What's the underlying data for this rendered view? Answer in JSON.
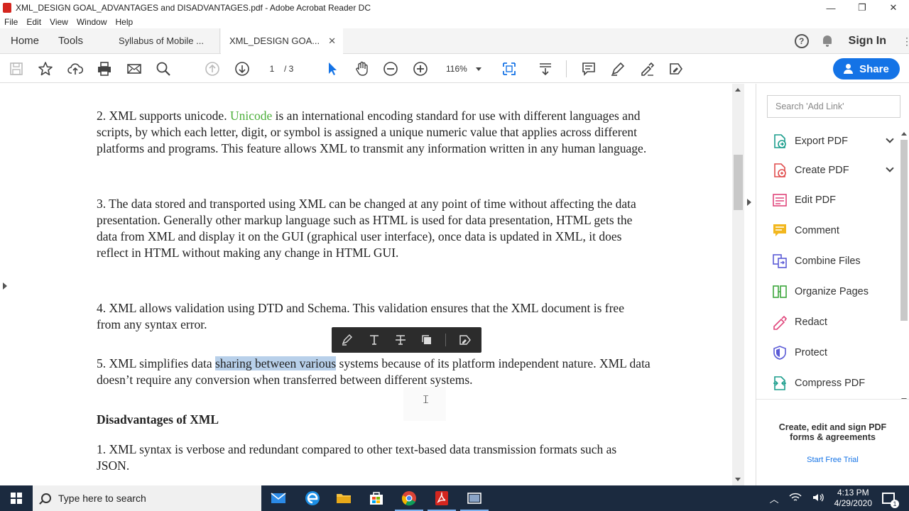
{
  "window": {
    "title": "XML_DESIGN GOAL_ADVANTAGES and DISADVANTAGES.pdf - Adobe Acrobat Reader DC",
    "controls": {
      "minimize": "—",
      "restore": "❐",
      "close": "✕"
    }
  },
  "menubar": {
    "items": [
      "File",
      "Edit",
      "View",
      "Window",
      "Help"
    ]
  },
  "tabs": {
    "home": "Home",
    "tools": "Tools",
    "documents": [
      {
        "label": "Syllabus of Mobile ...",
        "active": false
      },
      {
        "label": "XML_DESIGN GOA...",
        "active": true,
        "close": "✕"
      }
    ],
    "help": "?",
    "sign_in": "Sign In",
    "more": "⋮"
  },
  "toolbar": {
    "page_current": "1",
    "page_total": "/ 3",
    "zoom": "116%",
    "share_label": "Share",
    "colors": {
      "share_bg": "#1473e6",
      "selection_tool": "#1473e6"
    }
  },
  "document": {
    "para2": {
      "num": "2. XML supports unicode. ",
      "link": "Unicode",
      "rest": " is an international encoding standard for use with different languages and scripts, by which each letter, digit, or symbol is assigned a unique numeric value that applies across different platforms and programs. This feature allows XML to transmit any information written in any human language."
    },
    "para3": "3. The data stored and transported using XML can be changed at any point of time without affecting the data presentation. Generally other markup language such as HTML is used for data presentation, HTML gets the data from XML and display it on the GUI (graphical user interface), once data is updated in XML, it does reflect in HTML without making any change in HTML GUI.",
    "para4": "4. XML allows validation using DTD and Schema. This validation ensures that the XML document is free from any syntax error.",
    "para5": {
      "before": "5. XML simplifies data ",
      "selected": "sharing between various",
      "after": " systems because of its platform independent nature. XML data doesn’t require any conversion when transferred between different systems."
    },
    "heading_disadvantages": "Disadvantages of XML",
    "dis1": "1. XML syntax is verbose and redundant compared to other text-based data transmission formats such as JSON.",
    "colors": {
      "link": "#4caf3a",
      "selection": "#b8d0ea"
    }
  },
  "selection_toolbar": {
    "icons": [
      "highlight-icon",
      "strikethrough-text-icon",
      "replace-text-icon",
      "copy-icon",
      "more-options-icon"
    ]
  },
  "right_pane": {
    "search_placeholder": "Search 'Add Link'",
    "tools": [
      {
        "label": "Export PDF",
        "icon": "export-pdf-icon",
        "expandable": true,
        "color": "#1a9d8c"
      },
      {
        "label": "Create PDF",
        "icon": "create-pdf-icon",
        "expandable": true,
        "color": "#e04c4c"
      },
      {
        "label": "Edit PDF",
        "icon": "edit-pdf-icon",
        "expandable": false,
        "color": "#e0457b"
      },
      {
        "label": "Comment",
        "icon": "comment-icon",
        "expandable": false,
        "color": "#f2b71f"
      },
      {
        "label": "Combine Files",
        "icon": "combine-files-icon",
        "expandable": false,
        "color": "#5b5bd6"
      },
      {
        "label": "Organize Pages",
        "icon": "organize-pages-icon",
        "expandable": false,
        "color": "#3ca63c"
      },
      {
        "label": "Redact",
        "icon": "redact-icon",
        "expandable": false,
        "color": "#e0457b"
      },
      {
        "label": "Protect",
        "icon": "protect-icon",
        "expandable": false,
        "color": "#5b5bd6"
      },
      {
        "label": "Compress PDF",
        "icon": "compress-pdf-icon",
        "expandable": false,
        "color": "#1a9d8c"
      }
    ],
    "promo": {
      "title_line1": "Create, edit and sign PDF",
      "title_line2": "forms & agreements",
      "trial": "Start Free Trial"
    }
  },
  "taskbar": {
    "search_placeholder": "Type here to search",
    "time": "4:13 PM",
    "date": "4/29/2020",
    "notification_count": "1"
  }
}
